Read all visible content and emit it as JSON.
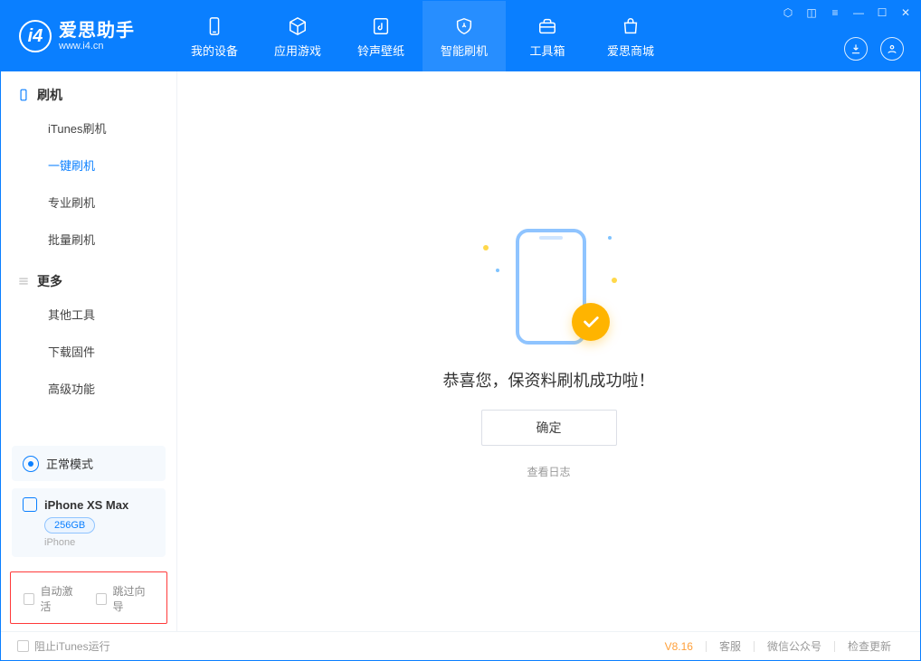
{
  "app": {
    "name_cn": "爱思助手",
    "name_en": "www.i4.cn"
  },
  "nav": {
    "items": [
      {
        "label": "我的设备",
        "icon": "device"
      },
      {
        "label": "应用游戏",
        "icon": "cube"
      },
      {
        "label": "铃声壁纸",
        "icon": "music"
      },
      {
        "label": "智能刷机",
        "icon": "shield"
      },
      {
        "label": "工具箱",
        "icon": "toolbox"
      },
      {
        "label": "爱思商城",
        "icon": "bag"
      }
    ],
    "active_index": 3
  },
  "sidebar": {
    "section1": {
      "title": "刷机",
      "items": [
        "iTunes刷机",
        "一键刷机",
        "专业刷机",
        "批量刷机"
      ],
      "active_index": 1
    },
    "section2": {
      "title": "更多",
      "items": [
        "其他工具",
        "下载固件",
        "高级功能"
      ]
    },
    "mode_label": "正常模式",
    "device": {
      "name": "iPhone XS Max",
      "capacity": "256GB",
      "type": "iPhone"
    },
    "checks": {
      "auto_activate": "自动激活",
      "skip_guide": "跳过向导"
    }
  },
  "main": {
    "success_message": "恭喜您，保资料刷机成功啦！",
    "ok_button": "确定",
    "view_log": "查看日志"
  },
  "footer": {
    "block_itunes": "阻止iTunes运行",
    "version": "V8.16",
    "links": [
      "客服",
      "微信公众号",
      "检查更新"
    ]
  }
}
